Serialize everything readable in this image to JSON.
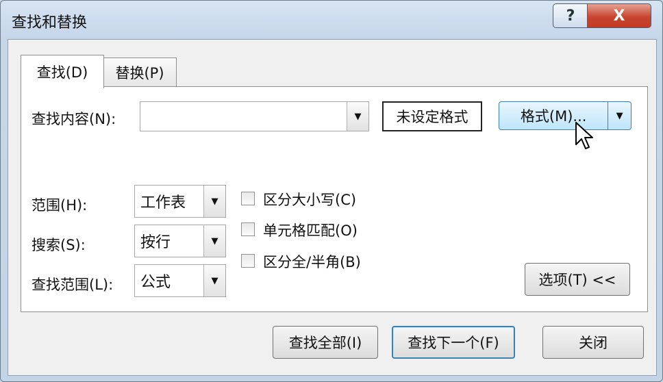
{
  "window": {
    "title": "查找和替换",
    "help_label": "?",
    "close_label": "X"
  },
  "tabs": [
    {
      "label": "查找(D)"
    },
    {
      "label": "替换(P)"
    }
  ],
  "find": {
    "label": "查找内容(N):",
    "value": "",
    "format_status": "未设定格式",
    "format_button": "格式(M)..."
  },
  "options": {
    "scope": {
      "label": "范围(H):",
      "value": "工作表"
    },
    "search": {
      "label": "搜索(S):",
      "value": "按行"
    },
    "look_in": {
      "label": "查找范围(L):",
      "value": "公式"
    }
  },
  "checkboxes": [
    {
      "label": "区分大小写(C)",
      "checked": false
    },
    {
      "label": "单元格匹配(O)",
      "checked": false
    },
    {
      "label": "区分全/半角(B)",
      "checked": false
    }
  ],
  "buttons": {
    "options": "选项(T) <<",
    "find_all": "查找全部(I)",
    "find_next": "查找下一个(F)",
    "close": "关闭"
  },
  "icons": {
    "dropdown": "chevron-down-icon",
    "cursor": "mouse-pointer-icon"
  }
}
